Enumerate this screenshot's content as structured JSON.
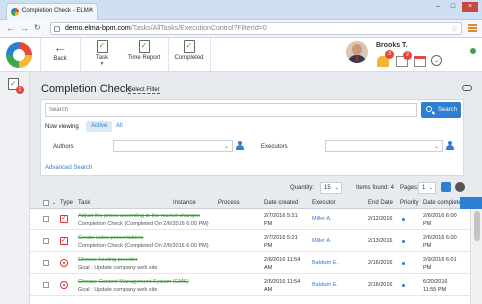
{
  "browser": {
    "tab_title": "Completion Check - ELMA",
    "url_host": "demo.elma-bpm.com",
    "url_path": "/Tasks/AllTasks/ExecutionControl?FilterId=0"
  },
  "toolbar": {
    "back_label": "Back",
    "task_label": "Task",
    "time_report_label": "Time Report",
    "completed_label": "Completed",
    "user_name": "Brooks T.",
    "notif_bell_count": "3",
    "notif_msg_count": "2"
  },
  "rail": {
    "badge": "1"
  },
  "page": {
    "title": "Completion Check",
    "select_filter": "Select Filter"
  },
  "filter": {
    "search_placeholder": "Search",
    "search_button": "Search",
    "now_viewing": "Now viewing",
    "view_active": "Active",
    "view_all": "All",
    "authors_label": "Authors",
    "executors_label": "Executors",
    "advanced_search": "Advanced Search"
  },
  "grid_toolbar": {
    "quantity_label": "Quantity:",
    "quantity_value": "15",
    "items_found": "Items found: 4",
    "pages_label": "Pages:",
    "pages_value": "1"
  },
  "table": {
    "headers": {
      "type": "Type",
      "task": "Task",
      "instance": "Instance",
      "process": "Process",
      "date_created": "Date created",
      "executor": "Executor",
      "end_date": "End Date",
      "priority": "Priority",
      "date_completed": "Date completed"
    },
    "rows": [
      {
        "task": "Adjust the prices according to the market changes",
        "sub": "Completion Check (Completed On 2/6/2016 6:00 PM)",
        "created_1": "2/7/2016 5:21",
        "created_2": "PM",
        "executor": "Miller A.",
        "end_date": "2/12/2016",
        "completed_1": "2/6/2016 6:00",
        "completed_2": "PM",
        "icon": "check"
      },
      {
        "task": "Create sales presentations",
        "sub": "Completion Check (Completed On 2/6/2016 6:00 PM)",
        "created_1": "2/7/2016 5:21",
        "created_2": "PM",
        "executor": "Miller A.",
        "end_date": "2/13/2016",
        "completed_1": "2/6/2016 6:00",
        "completed_2": "PM",
        "icon": "check"
      },
      {
        "task": "Choose hosting provider",
        "sub": "Goal : Update company web site",
        "created_1": "2/6/2016 11:54",
        "created_2": "AM",
        "executor": "Baldwin E.",
        "end_date": "2/16/2016",
        "completed_1": "2/9/2016 6:01",
        "completed_2": "PM",
        "icon": "goal"
      },
      {
        "task": "Choose Content Management System (CMS)",
        "sub": "Goal : Update company web site",
        "created_1": "2/6/2016 11:54",
        "created_2": "AM",
        "executor": "Baldwin E.",
        "end_date": "2/16/2016",
        "completed_1": "6/20/2016",
        "completed_2": "11:55 PM",
        "icon": "goal"
      }
    ]
  },
  "colors": {
    "accent": "#2e7fd3",
    "done_text": "#3a9a3a",
    "alert": "#e8483a"
  }
}
